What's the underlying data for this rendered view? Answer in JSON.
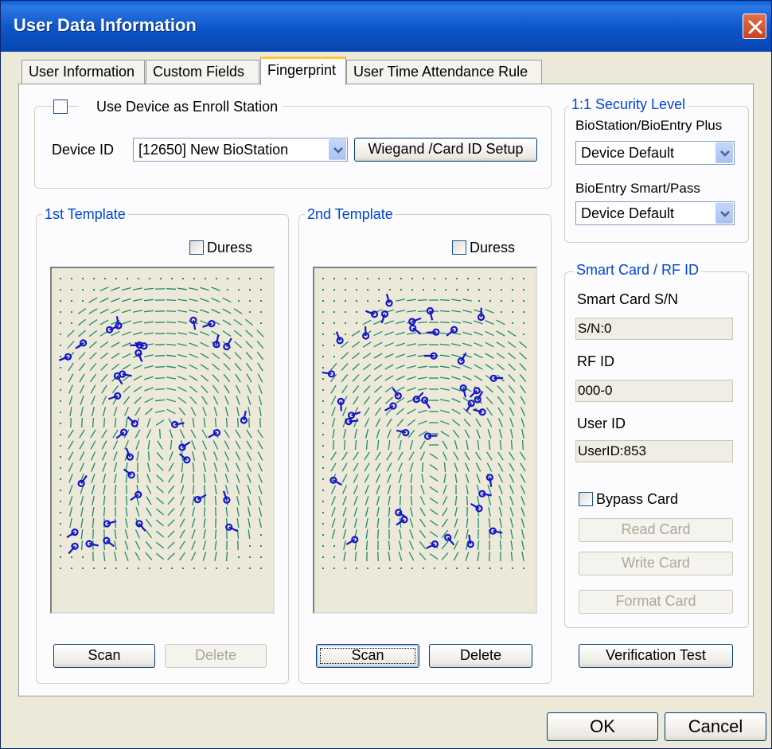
{
  "window": {
    "title": "User Data Information"
  },
  "tabs": [
    {
      "label": "User Information",
      "active": false
    },
    {
      "label": "Custom Fields",
      "active": false
    },
    {
      "label": "Fingerprint",
      "active": true
    },
    {
      "label": "User Time Attendance Rule",
      "active": false
    }
  ],
  "enroll": {
    "use_device_label": "Use Device as Enroll Station",
    "use_device_checked": false,
    "device_id_label": "Device ID",
    "device_id_value": "[12650] New BioStation",
    "wiegand_button": "Wiegand /Card ID Setup"
  },
  "template1": {
    "title": "1st Template",
    "duress_label": "Duress",
    "scan_button": "Scan",
    "delete_button": "Delete"
  },
  "template2": {
    "title": "2nd Template",
    "duress_label": "Duress",
    "scan_button": "Scan",
    "delete_button": "Delete"
  },
  "security": {
    "title": "1:1 Security Level",
    "biostation_label": "BioStation/BioEntry Plus",
    "biostation_value": "Device Default",
    "bioentry_label": "BioEntry Smart/Pass",
    "bioentry_value": "Device Default"
  },
  "smartcard": {
    "title": "Smart Card / RF ID",
    "sn_label": "Smart Card S/N",
    "sn_value": "S/N:0",
    "rfid_label": "RF ID",
    "rfid_value": "000-0",
    "userid_label": "User ID",
    "userid_value": "UserID:853",
    "bypass_label": "Bypass Card",
    "read_button": "Read Card",
    "write_button": "Write Card",
    "format_button": "Format Card"
  },
  "verification_button": "Verification Test",
  "footer": {
    "ok_button": "OK",
    "cancel_button": "Cancel"
  },
  "colors": {
    "title_bar": "#0a5fd8",
    "group_title": "#0046d5",
    "ridge": "#1f8a6e",
    "minutia": "#1414c8"
  },
  "icons": {
    "close": "close-icon",
    "dropdown": "chevron-down-icon",
    "fingerprint": "fingerprint-image"
  }
}
